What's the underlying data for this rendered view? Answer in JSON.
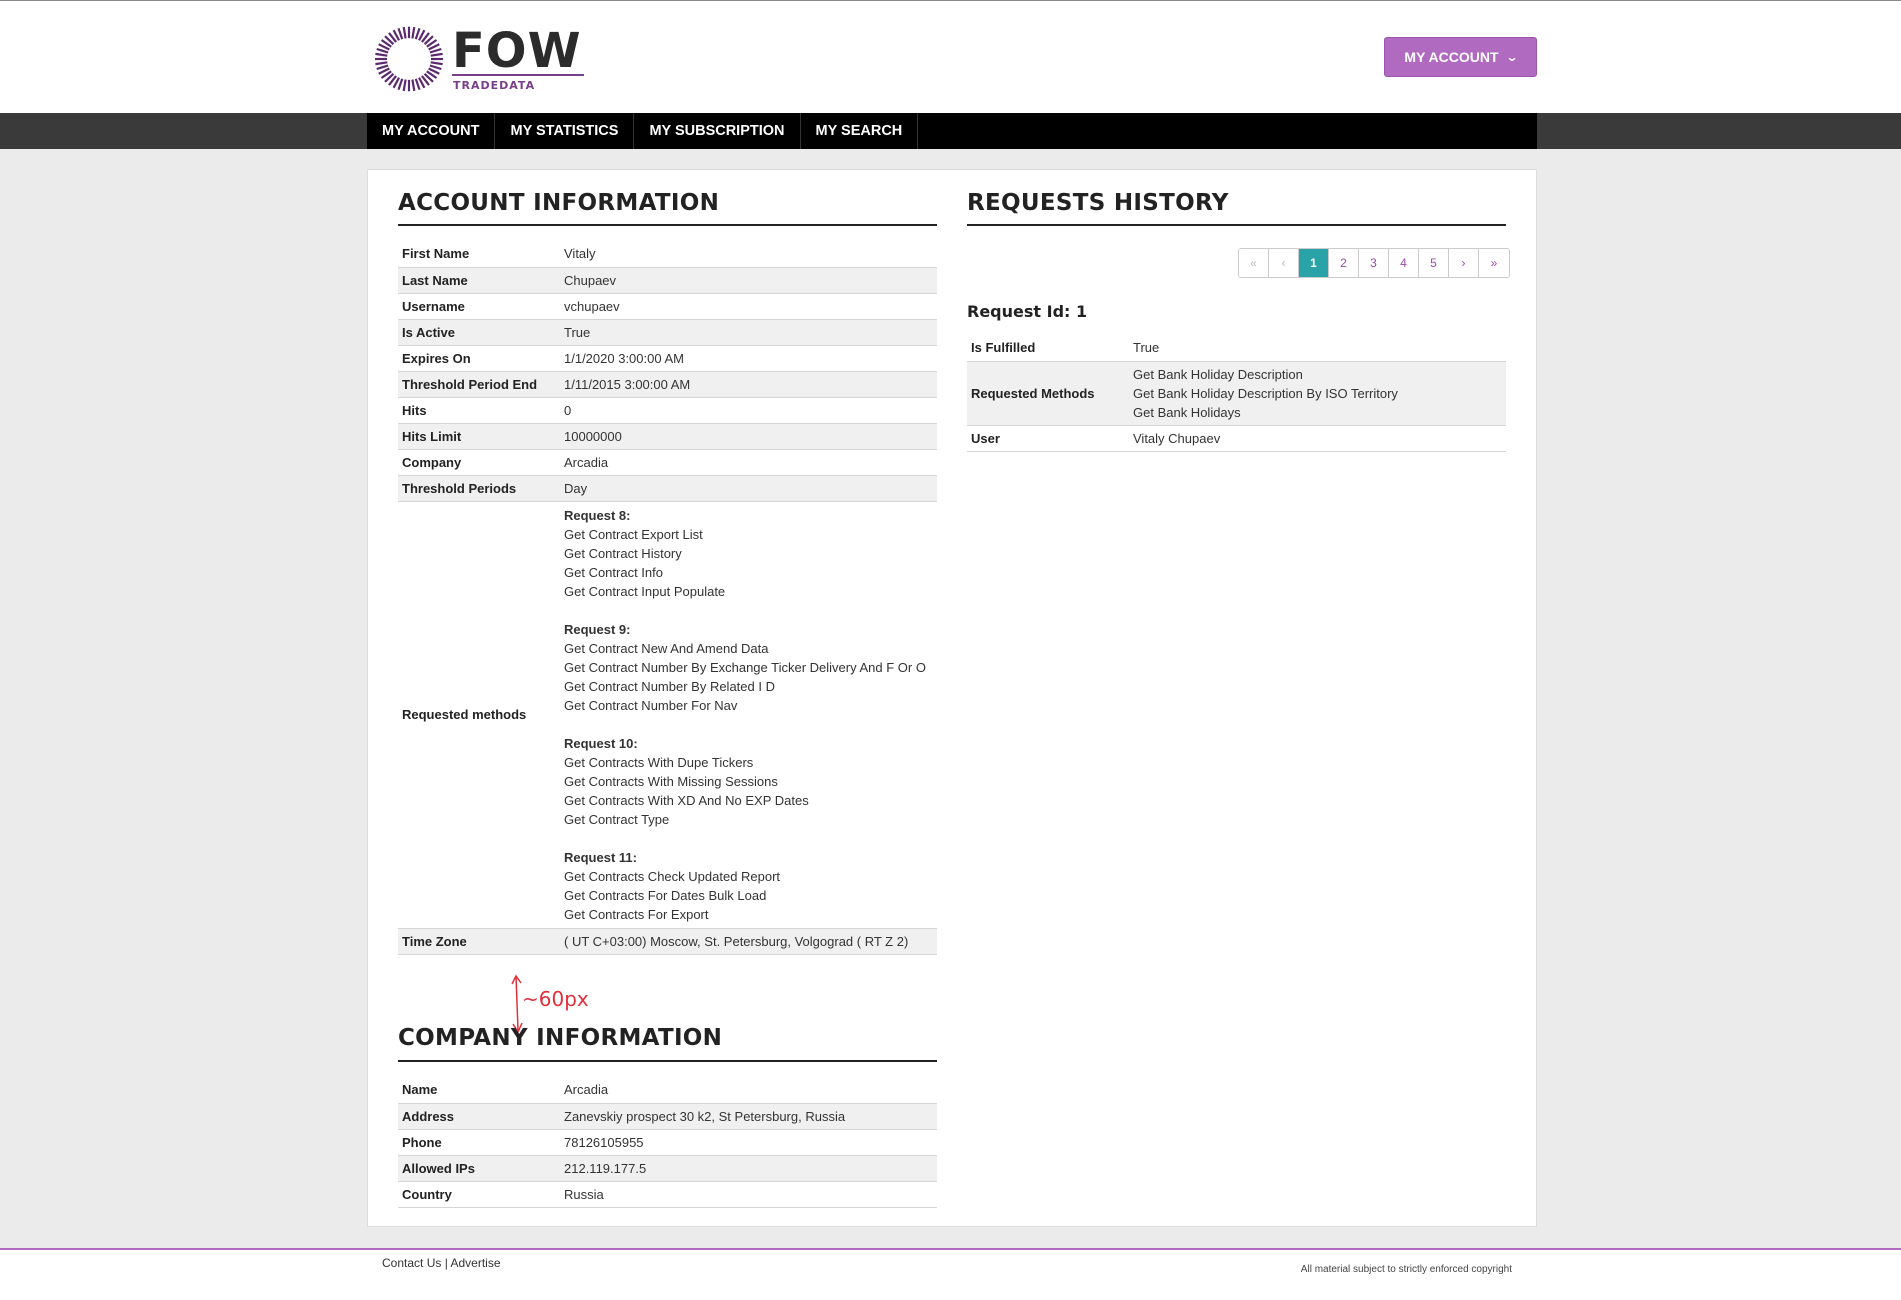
{
  "header": {
    "logo_text": "FOW",
    "logo_sub": "TRADEDATA",
    "account_button": "MY ACCOUNT"
  },
  "nav": [
    {
      "label": "MY ACCOUNT"
    },
    {
      "label": "MY STATISTICS"
    },
    {
      "label": "MY SUBSCRIPTION"
    },
    {
      "label": "MY SEARCH"
    }
  ],
  "account": {
    "title": "ACCOUNT INFORMATION",
    "rows": [
      {
        "k": "First Name",
        "v": "Vitaly"
      },
      {
        "k": "Last Name",
        "v": "Chupaev"
      },
      {
        "k": "Username",
        "v": "vchupaev"
      },
      {
        "k": "Is Active",
        "v": "True"
      },
      {
        "k": "Expires On",
        "v": "1/1/2020 3:00:00 AM"
      },
      {
        "k": "Threshold Period End",
        "v": "1/11/2015 3:00:00 AM"
      },
      {
        "k": "Hits",
        "v": "0"
      },
      {
        "k": "Hits Limit",
        "v": "10000000"
      },
      {
        "k": "Company",
        "v": "Arcadia"
      },
      {
        "k": "Threshold Periods",
        "v": "Day"
      }
    ],
    "requested_methods_label": "Requested methods",
    "requests": [
      {
        "head": "Request 8:",
        "items": [
          "Get Contract Export List",
          "Get Contract History",
          "Get Contract Info",
          "Get Contract Input Populate"
        ]
      },
      {
        "head": "Request 9:",
        "items": [
          "Get Contract New And Amend Data",
          "Get Contract Number By Exchange Ticker Delivery And F Or O",
          "Get Contract Number By Related I D",
          "Get Contract Number For Nav"
        ]
      },
      {
        "head": "Request 10:",
        "items": [
          "Get Contracts With Dupe Tickers",
          "Get Contracts With Missing Sessions",
          "Get Contracts With XD And No EXP Dates",
          "Get Contract Type"
        ]
      },
      {
        "head": "Request 11:",
        "items": [
          "Get Contracts Check Updated Report",
          "Get Contracts For Dates Bulk Load",
          "Get Contracts For Export"
        ]
      }
    ],
    "timezone_label": "Time Zone",
    "timezone_value": "( UT C+03:00) Moscow, St. Petersburg, Volgograd ( RT Z 2)"
  },
  "annotation": {
    "text": "~60px",
    "color": "#e0303a"
  },
  "company": {
    "title": "COMPANY INFORMATION",
    "rows": [
      {
        "k": "Name",
        "v": "Arcadia"
      },
      {
        "k": "Address",
        "v": "Zanevskiy prospect 30 k2, St Petersburg, Russia"
      },
      {
        "k": "Phone",
        "v": "78126105955"
      },
      {
        "k": "Allowed IPs",
        "v": "212.119.177.5"
      },
      {
        "k": "Country",
        "v": "Russia"
      }
    ]
  },
  "history": {
    "title": "REQUESTS HISTORY",
    "pager": {
      "first": "«",
      "prev": "‹",
      "pages": [
        "1",
        "2",
        "3",
        "4",
        "5"
      ],
      "active": "1",
      "next": "›",
      "last": "»"
    },
    "request_id": "Request Id: 1",
    "fulfilled_label": "Is Fulfilled",
    "fulfilled_value": "True",
    "methods_label": "Requested Methods",
    "methods": [
      "Get Bank Holiday Description",
      "Get Bank Holiday Description By ISO Territory",
      "Get Bank Holidays"
    ],
    "user_label": "User",
    "user_value": "Vitaly Chupaev"
  },
  "footer": {
    "contact": "Contact Us",
    "sep": "|",
    "advertise": "Advertise",
    "copyright": "All material subject to strictly enforced copyright"
  },
  "colors": {
    "accent": "#b06ac0",
    "brand": "#7a3f89",
    "pager_active": "#2aa3a8"
  }
}
